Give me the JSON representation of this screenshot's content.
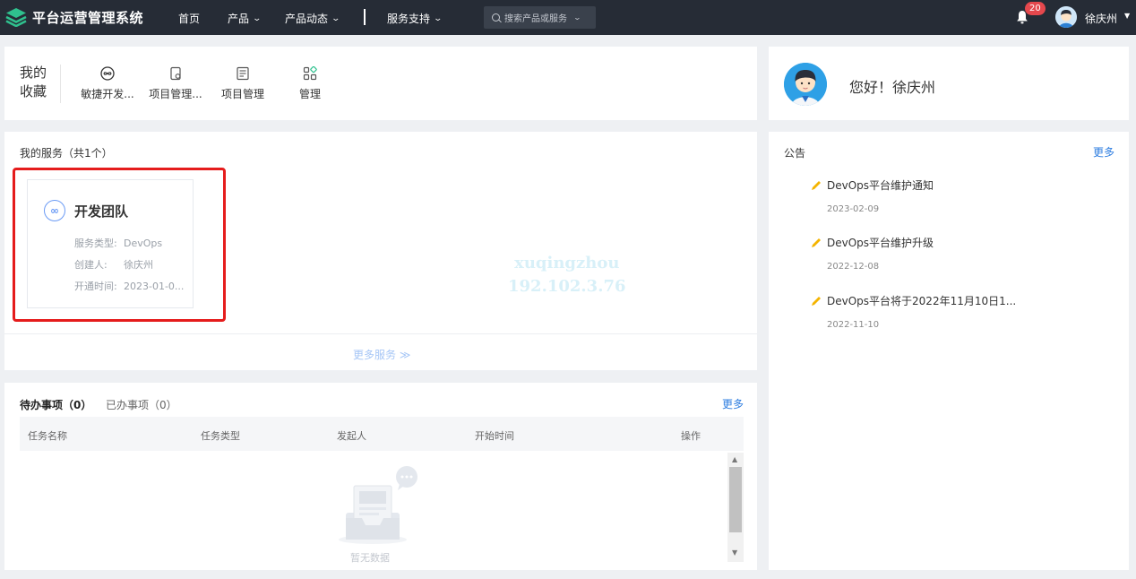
{
  "app": {
    "title": "平台运营管理系统"
  },
  "nav": {
    "items": [
      {
        "label": "首页",
        "has_dropdown": false
      },
      {
        "label": "产品",
        "has_dropdown": true
      },
      {
        "label": "产品动态",
        "has_dropdown": true
      },
      {
        "label": "服务支持",
        "has_dropdown": true
      }
    ],
    "search_placeholder": "搜索产品或服务"
  },
  "user": {
    "notification_count": "20",
    "name": "徐庆州"
  },
  "favorites": {
    "title": "我的收藏",
    "items": [
      {
        "label": "敏捷开发...",
        "icon": "infinity-icon"
      },
      {
        "label": "项目管理...",
        "icon": "project-settings-icon"
      },
      {
        "label": "项目管理",
        "icon": "list-doc-icon"
      },
      {
        "label": "管理",
        "icon": "app-grid-icon"
      }
    ]
  },
  "greeting": {
    "text": "您好！徐庆州"
  },
  "services": {
    "header": "我的服务（共1个）",
    "cards": [
      {
        "name": "开发团队",
        "type_label": "服务类型:",
        "type_value": "DevOps",
        "creator_label": "创建人:",
        "creator_value": "徐庆州",
        "opened_label": "开通时间:",
        "opened_value": "2023-01-0..."
      }
    ],
    "more_label": "更多服务 ≫"
  },
  "watermark": {
    "line1": "xuqingzhou",
    "line2": "192.102.3.76"
  },
  "todos": {
    "tab_pending": "待办事项（0）",
    "tab_done": "已办事项（0）",
    "more_label": "更多",
    "columns": [
      "任务名称",
      "任务类型",
      "发起人",
      "开始时间",
      "操作"
    ],
    "empty_text": "暂无数据"
  },
  "notices": {
    "header": "公告",
    "more_label": "更多",
    "items": [
      {
        "title": "DevOps平台维护通知",
        "date": "2023-02-09"
      },
      {
        "title": "DevOps平台维护升级",
        "date": "2022-12-08"
      },
      {
        "title": "DevOps平台将于2022年11月10日1...",
        "date": "2022-11-10"
      }
    ]
  },
  "colors": {
    "topbar": "#262c36",
    "accent": "#2d7de0",
    "highlight": "#e51c1c",
    "badge": "#e5484d",
    "logo": "#2fc18e"
  }
}
